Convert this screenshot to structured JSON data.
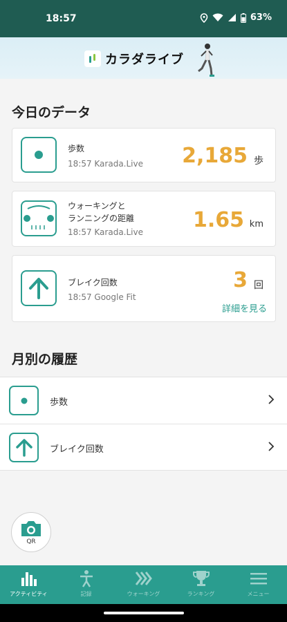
{
  "status": {
    "time": "18:57",
    "battery": "63%"
  },
  "header": {
    "logo_text": "カラダライブ"
  },
  "today": {
    "title": "今日のデータ",
    "steps": {
      "label": "歩数",
      "sub": "18:57 Karada.Live",
      "value": "2,185",
      "unit": "歩"
    },
    "distance": {
      "label_line1": "ウォーキングと",
      "label_line2": "ランニングの距離",
      "sub": "18:57 Karada.Live",
      "value": "1.65",
      "unit": "km"
    },
    "breaks": {
      "label": "ブレイク回数",
      "sub": "18:57 Google Fit",
      "value": "3",
      "unit": "回",
      "link": "詳細を見る"
    }
  },
  "monthly": {
    "title": "月別の履歴",
    "items": [
      {
        "label": "歩数"
      },
      {
        "label": "ブレイク回数"
      }
    ]
  },
  "qr": {
    "label": "QR"
  },
  "tabs": [
    {
      "label": "アクティビティ",
      "icon": "bar-chart-icon",
      "active": true
    },
    {
      "label": "記録",
      "icon": "person-icon",
      "active": false
    },
    {
      "label": "ウォーキング",
      "icon": "chevrons-icon",
      "active": false
    },
    {
      "label": "ランキング",
      "icon": "trophy-icon",
      "active": false
    },
    {
      "label": "メニュー",
      "icon": "menu-icon",
      "active": false
    }
  ],
  "colors": {
    "primary": "#2a9d8f",
    "statusbar": "#1f5c52",
    "value": "#e8a838"
  }
}
